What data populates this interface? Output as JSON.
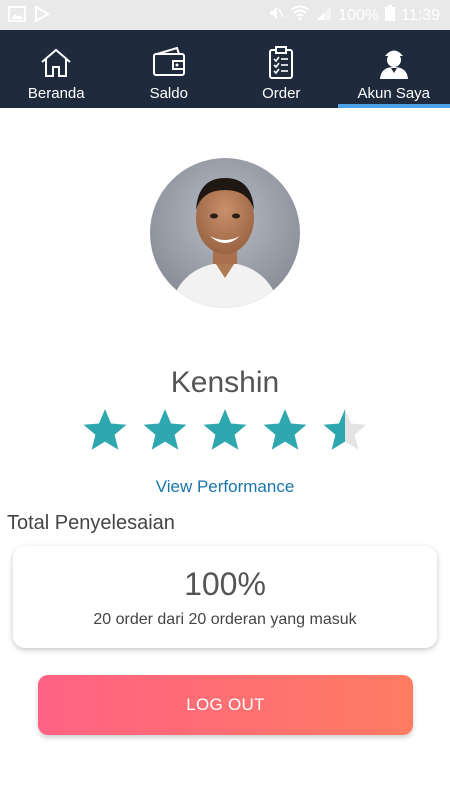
{
  "statusbar": {
    "battery": "100%",
    "time": "11:39",
    "icons": [
      "image-icon",
      "play-store-icon",
      "mute-icon",
      "wifi-icon",
      "signal-icon",
      "battery-icon"
    ]
  },
  "navbar": {
    "items": [
      {
        "label": "Beranda",
        "icon": "home-icon"
      },
      {
        "label": "Saldo",
        "icon": "wallet-icon"
      },
      {
        "label": "Order",
        "icon": "clipboard-icon"
      },
      {
        "label": "Akun Saya",
        "icon": "user-account-icon",
        "active": true
      }
    ],
    "background": "#1f2a3d",
    "active_indicator": "#4aa3e6"
  },
  "profile": {
    "name": "Kenshin",
    "rating": 4.5,
    "rating_max": 5,
    "star_color": "#2ea8ae",
    "view_performance": "View Performance"
  },
  "completion": {
    "title": "Total Penyelesaian",
    "percentage": "100%",
    "description": "20 order dari 20 orderan yang masuk"
  },
  "logout": {
    "label": "LOG OUT",
    "gradient": [
      "#ff6284",
      "#ff7c62"
    ]
  }
}
